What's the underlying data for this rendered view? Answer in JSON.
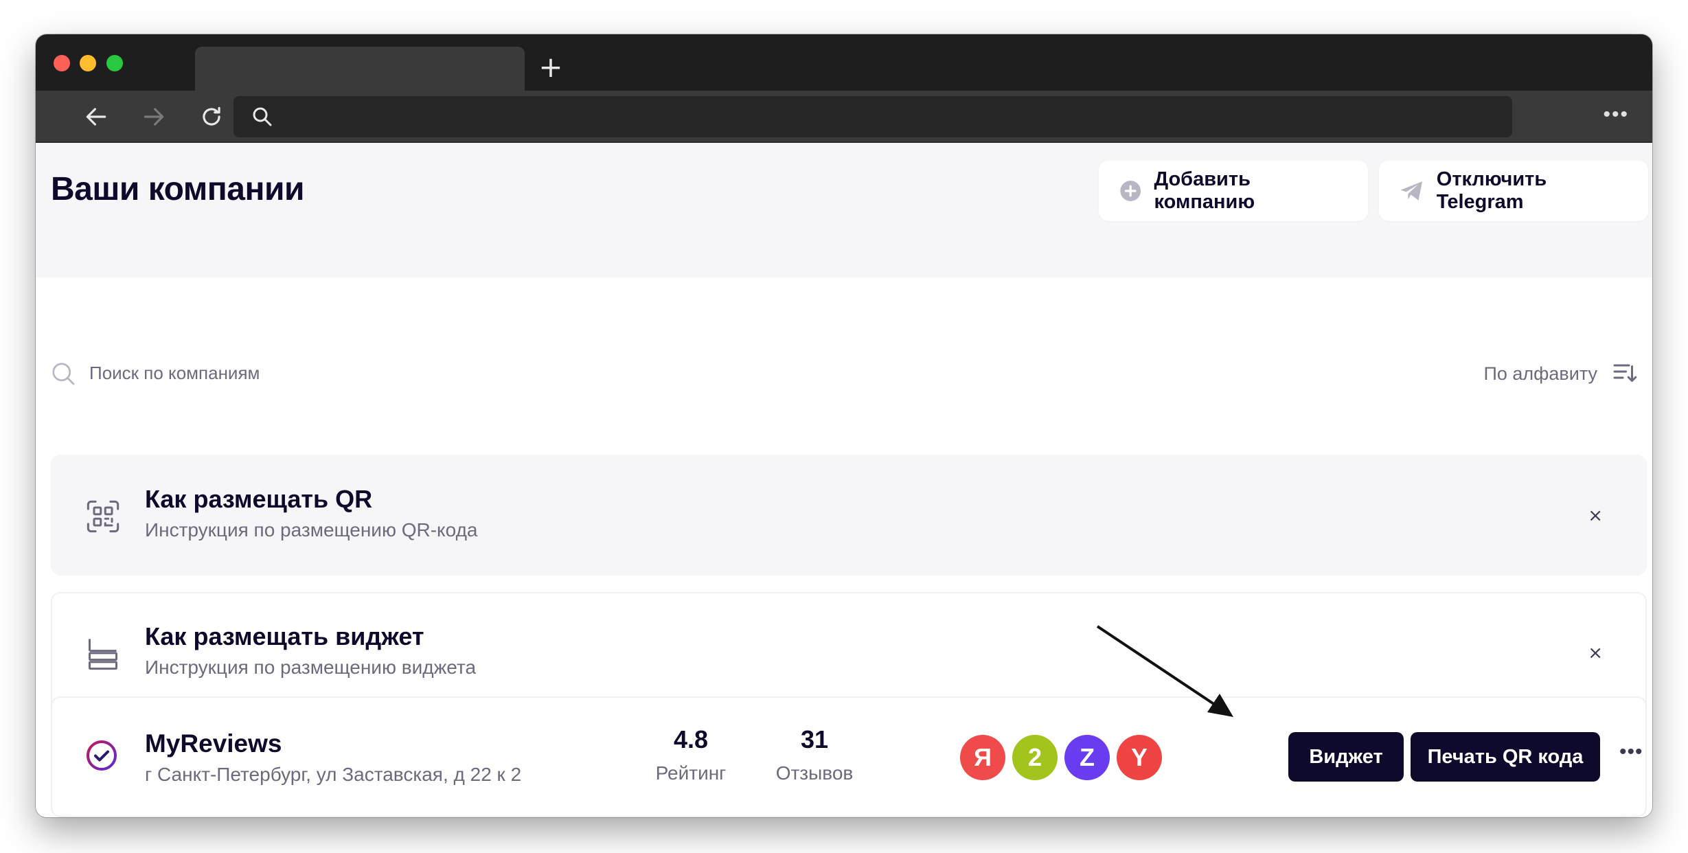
{
  "browser": {
    "new_tab_glyph": "+",
    "menu_glyph": "•••",
    "icons": [
      "back-arrow-icon",
      "forward-arrow-icon",
      "reload-icon",
      "search-icon",
      "more-icon"
    ]
  },
  "header": {
    "title": "Ваши компании",
    "add_company_label": "Добавить компанию",
    "disable_telegram_label": "Отключить Telegram"
  },
  "search": {
    "placeholder": "Поиск по компаниям",
    "sort_label": "По алфавиту"
  },
  "info_cards": [
    {
      "title": "Как размещать QR",
      "subtitle": "Инструкция по размещению QR-кода",
      "close": "×",
      "icon": "qr-scan-icon"
    },
    {
      "title": "Как размещать виджет",
      "subtitle": "Инструкция по размещению виджета",
      "close": "×",
      "icon": "widget-layout-icon"
    }
  ],
  "company": {
    "name": "MyReviews",
    "address": "г Санкт-Петербург, ул Заставская, д 22 к 2",
    "rating_value": "4.8",
    "rating_label": "Рейтинг",
    "reviews_value": "31",
    "reviews_label": "Отзывов",
    "platforms": [
      {
        "letter": "Я",
        "color": "#ef4b4b"
      },
      {
        "letter": "2",
        "color": "#a3c41c"
      },
      {
        "letter": "Z",
        "color": "#6a3cf0"
      },
      {
        "letter": "Y",
        "color": "#ef4444"
      }
    ],
    "widget_label": "Виджет",
    "print_qr_label": "Печать QR кода",
    "more_glyph": "•••"
  },
  "colors": {
    "primary_dark": "#0d0a2c",
    "muted_text": "#6b6a7e",
    "accent_purple": "#7b3bd6"
  }
}
